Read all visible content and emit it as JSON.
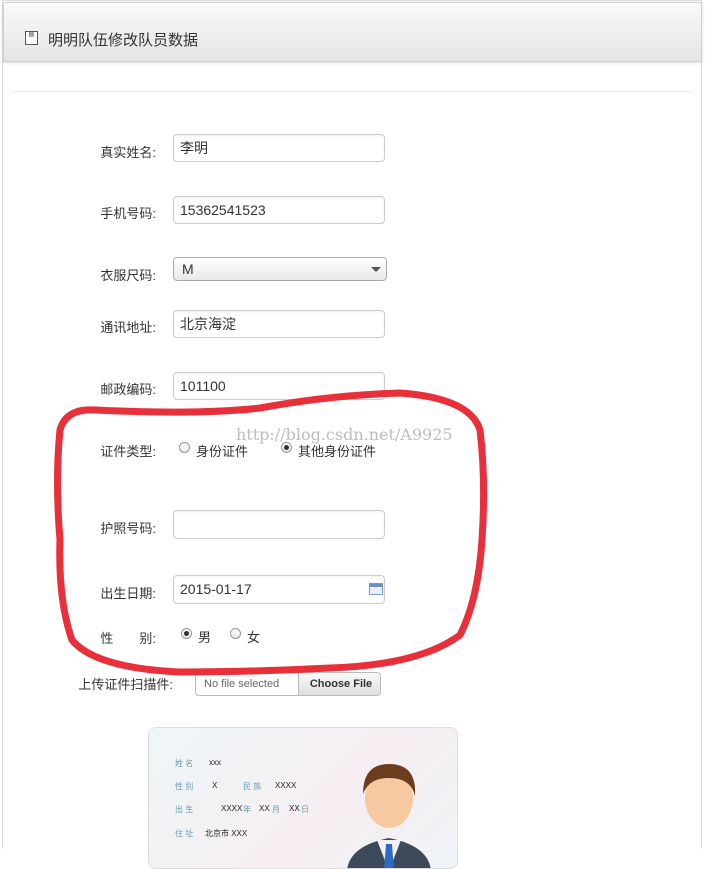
{
  "header": {
    "title": "明明队伍修改队员数据",
    "icon": "form-icon"
  },
  "form": {
    "real_name": {
      "label": "真实姓名:",
      "value": "李明"
    },
    "phone": {
      "label": "手机号码:",
      "value": "15362541523"
    },
    "size": {
      "label": "衣服尺码:",
      "value": "M"
    },
    "address": {
      "label": "通讯地址:",
      "value": "北京海淀"
    },
    "postcode": {
      "label": "邮政编码:",
      "value": "101100"
    },
    "id_type": {
      "label": "证件类型:",
      "options": [
        "身份证件",
        "其他身份证件"
      ],
      "selected": "其他身份证件"
    },
    "passport": {
      "label": "护照号码:",
      "value": ""
    },
    "birthdate": {
      "label": "出生日期:",
      "value": "2015-01-17"
    },
    "gender": {
      "label": "性　　别:",
      "options": [
        "男",
        "女"
      ],
      "selected": "男"
    },
    "upload": {
      "label": "上传证件扫描件:",
      "file_text": "No file selected",
      "button": "Choose File"
    }
  },
  "watermark": "http://blog.csdn.net/A9925",
  "id_card": {
    "name_label": "姓 名",
    "name_value": "xxx",
    "sex_label": "性 别",
    "sex_value": "X",
    "ethnic_label": "民 族",
    "ethnic_value": "XXXX",
    "birth_label": "出 生",
    "birth_value": "XXXX",
    "year_label": "年",
    "month_value": "XX",
    "month_label": "月",
    "day_value": "XX",
    "day_label": "日",
    "addr_label": "住 址",
    "addr_value": "北京市 XXX"
  },
  "colors": {
    "annotation": "#e8303a",
    "accent": "#6a8fc4"
  }
}
